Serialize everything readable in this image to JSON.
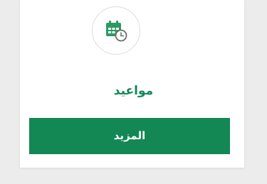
{
  "card": {
    "icon": "calendar-clock-icon",
    "title": "مواعيد",
    "button_label": "المزيد"
  },
  "colors": {
    "accent": "#138855",
    "title": "#0f8a5a",
    "icon": "#2e9a63",
    "clock": "#6e6e6e",
    "background": "#ececec",
    "card": "#ffffff"
  }
}
